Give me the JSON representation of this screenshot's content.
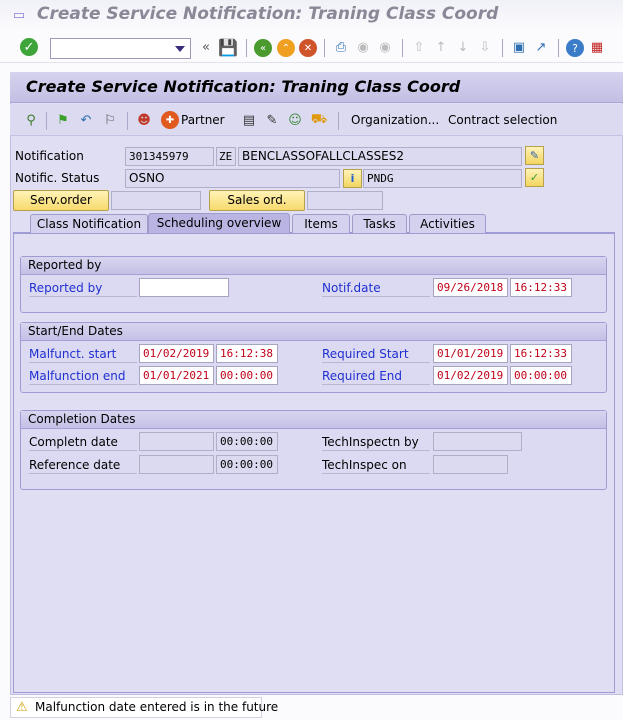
{
  "window": {
    "title": "Create Service Notification: Traning Class Coord"
  },
  "system_toolbar": {
    "command_field": {
      "value": "",
      "placeholder": ""
    }
  },
  "screen": {
    "title": "Create Service Notification: Traning Class Coord"
  },
  "app_toolbar": {
    "partner_label": "Partner",
    "organization_label": "Organization...",
    "contract_label": "Contract selection"
  },
  "header": {
    "notification_label": "Notification",
    "notification_number": "301345979",
    "notification_type": "ZE",
    "notification_desc": "BENCLASSOFALLCLASSES2",
    "status_label": "Notific. Status",
    "system_status": "OSNO",
    "user_status": "PNDG",
    "serv_order_label": "Serv.order",
    "serv_order_value": "",
    "sales_ord_label": "Sales ord.",
    "sales_ord_value": ""
  },
  "tabs": [
    {
      "label": "Class Notification",
      "active": false
    },
    {
      "label": "Scheduling overview",
      "active": true
    },
    {
      "label": "Items",
      "active": false
    },
    {
      "label": "Tasks",
      "active": false
    },
    {
      "label": "Activities",
      "active": false
    }
  ],
  "reported_by": {
    "title": "Reported by",
    "reported_by_label": "Reported by",
    "reported_by_value": "",
    "notif_date_label": "Notif.date",
    "notif_date": "09/26/2018",
    "notif_time": "16:12:33"
  },
  "start_end": {
    "title": "Start/End Dates",
    "malf_start_label": "Malfunct. start",
    "malf_start_date": "01/02/2019",
    "malf_start_time": "16:12:38",
    "malf_end_label": "Malfunction end",
    "malf_end_date": "01/01/2021",
    "malf_end_time": "00:00:00",
    "req_start_label": "Required Start",
    "req_start_date": "01/01/2019",
    "req_start_time": "16:12:33",
    "req_end_label": "Required End",
    "req_end_date": "01/02/2019",
    "req_end_time": "00:00:00"
  },
  "completion": {
    "title": "Completion Dates",
    "completn_label": "Completn date",
    "completn_date": "",
    "completn_time": "00:00:00",
    "reference_label": "Reference date",
    "reference_date": "",
    "reference_time": "00:00:00",
    "tech_by_label": "TechInspectn by",
    "tech_by_value": "",
    "tech_on_label": "TechInspec on",
    "tech_on_value": ""
  },
  "status_bar": {
    "message": "Malfunction date entered is in the future",
    "type": "warning"
  },
  "colors": {
    "accent": "#1f2fd0",
    "required": "#c00018",
    "panel": "#e0def3"
  }
}
